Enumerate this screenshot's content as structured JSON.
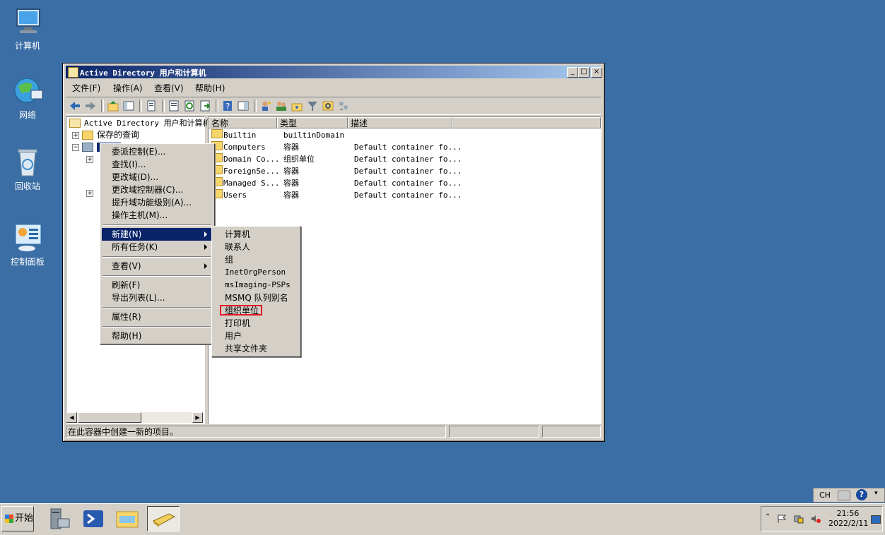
{
  "desktop": {
    "icons": [
      {
        "label": "计算机",
        "icon": "computer-icon"
      },
      {
        "label": "网络",
        "icon": "network-icon"
      },
      {
        "label": "回收站",
        "icon": "recycle-bin-icon"
      },
      {
        "label": "控制面板",
        "icon": "control-panel-icon"
      }
    ]
  },
  "window": {
    "title": "Active Directory 用户和计算机",
    "controls": {
      "minimize": "_",
      "maximize": "□",
      "close": "×"
    },
    "menubar": [
      "文件(F)",
      "操作(A)",
      "查看(V)",
      "帮助(H)"
    ],
    "tree": {
      "root": "Active Directory 用户和计算机",
      "saved_queries": "保存的查询",
      "domain_selected": ""
    },
    "list": {
      "columns": [
        "名称",
        "类型",
        "描述"
      ],
      "rows": [
        {
          "name": "Builtin",
          "type": "builtinDomain",
          "desc": ""
        },
        {
          "name": "Computers",
          "type": "容器",
          "desc": "Default container fo..."
        },
        {
          "name": "Domain Co...",
          "type": "组织单位",
          "desc": "Default container fo..."
        },
        {
          "name": "ForeignSe...",
          "type": "容器",
          "desc": "Default container fo..."
        },
        {
          "name": "Managed S...",
          "type": "容器",
          "desc": "Default container fo..."
        },
        {
          "name": "Users",
          "type": "容器",
          "desc": "Default container fo..."
        }
      ]
    },
    "status": "在此容器中创建一新的项目。"
  },
  "context_menu": {
    "items": [
      {
        "label": "委派控制(E)..."
      },
      {
        "label": "查找(I)..."
      },
      {
        "label": "更改域(D)..."
      },
      {
        "label": "更改域控制器(C)..."
      },
      {
        "label": "提升域功能级别(A)..."
      },
      {
        "label": "操作主机(M)..."
      },
      {
        "label": "新建(N)"
      },
      {
        "label": "所有任务(K)"
      },
      {
        "label": "查看(V)"
      },
      {
        "label": "刷新(F)"
      },
      {
        "label": "导出列表(L)..."
      },
      {
        "label": "属性(R)"
      },
      {
        "label": "帮助(H)"
      }
    ]
  },
  "submenu_new": {
    "items": [
      "计算机",
      "联系人",
      "组",
      "InetOrgPerson",
      "msImaging-PSPs",
      "MSMQ 队列别名",
      "组织单位",
      "打印机",
      "用户",
      "共享文件夹"
    ],
    "highlighted": "组织单位",
    "highlight_color": "#e81123"
  },
  "taskbar": {
    "start_label": "开始",
    "apps": [
      "server-manager-icon",
      "powershell-icon",
      "explorer-icon",
      "ad-users-computers-icon"
    ],
    "tray": {
      "time": "21:56",
      "date": "2022/2/11"
    },
    "langbar": {
      "lang": "CH"
    }
  },
  "colors": {
    "desktop": "#3a6ea5",
    "titlebar": "#0a246a",
    "menu_highlight": "#0a246a"
  }
}
